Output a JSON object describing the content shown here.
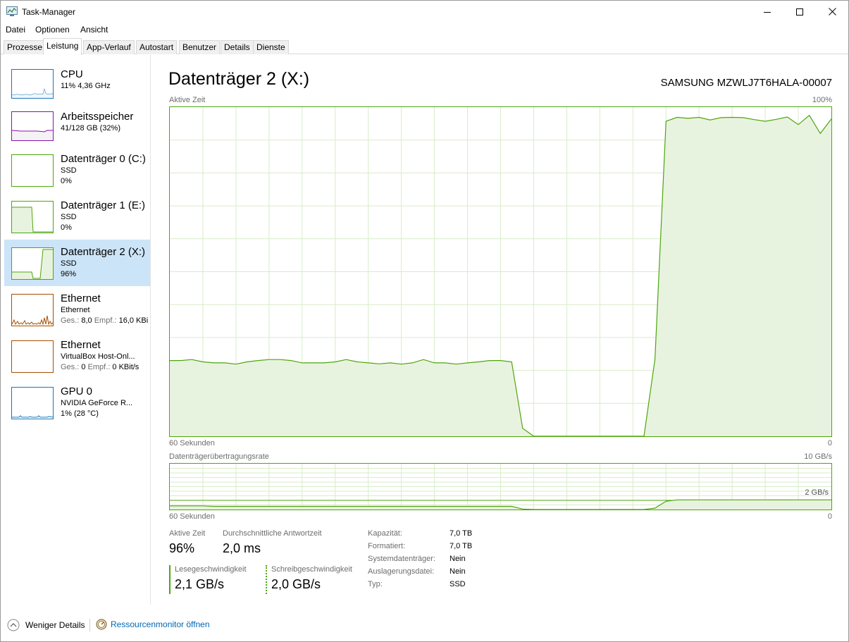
{
  "window": {
    "title": "Task-Manager"
  },
  "menu": [
    "Datei",
    "Optionen",
    "Ansicht"
  ],
  "tabs": [
    "Prozesse",
    "Leistung",
    "App-Verlauf",
    "Autostart",
    "Benutzer",
    "Details",
    "Dienste"
  ],
  "active_tab": "Leistung",
  "sidebar": {
    "items": [
      {
        "title": "CPU",
        "line1": "11% 4,36 GHz",
        "line2": "",
        "color": "#1779ba",
        "selected": false
      },
      {
        "title": "Arbeitsspeicher",
        "line1": "41/128 GB (32%)",
        "line2": "",
        "color": "#8b12ae",
        "selected": false
      },
      {
        "title": "Datenträger 0 (C:)",
        "line1": "SSD",
        "line2": "0%",
        "color": "#4da60c",
        "selected": false
      },
      {
        "title": "Datenträger 1 (E:)",
        "line1": "SSD",
        "line2": "0%",
        "color": "#4da60c",
        "selected": false
      },
      {
        "title": "Datenträger 2 (X:)",
        "line1": "SSD",
        "line2": "96%",
        "color": "#4da60c",
        "selected": true
      },
      {
        "title": "Ethernet",
        "line1": "Ethernet",
        "line2_key1": "Ges.:",
        "line2_val1": "8,0",
        "line2_key2": "Empf.:",
        "line2_val2": "16,0 KBi",
        "color": "#a74f01",
        "selected": false
      },
      {
        "title": "Ethernet",
        "line1": "VirtualBox Host-Onl...",
        "line2_key1": "Ges.:",
        "line2_val1": "0",
        "line2_key2": "Empf.:",
        "line2_val2": "0 KBit/s",
        "color": "#a74f01",
        "selected": false
      },
      {
        "title": "GPU 0",
        "line1": "NVIDIA GeForce R...",
        "line2": "1% (28 °C)",
        "color": "#1779ba",
        "selected": false
      }
    ]
  },
  "main": {
    "title": "Datenträger 2 (X:)",
    "model": "SAMSUNG MZWLJ7T6HALA-00007",
    "active_chart": {
      "label": "Aktive Zeit",
      "max_label": "100%",
      "x_left": "60 Sekunden",
      "x_right": "0"
    },
    "transfer_chart": {
      "label": "Datenträgerübertragungsrate",
      "max_label": "10 GB/s",
      "mid_label": "2 GB/s",
      "x_left": "60 Sekunden",
      "x_right": "0"
    },
    "stats": {
      "active_time_label": "Aktive Zeit",
      "active_time_value": "96%",
      "avg_response_label": "Durchschnittliche Antwortzeit",
      "avg_response_value": "2,0 ms",
      "read_label": "Lesegeschwindigkeit",
      "read_value": "2,1 GB/s",
      "write_label": "Schreibgeschwindigkeit",
      "write_value": "2,0 GB/s"
    },
    "properties": [
      {
        "key": "Kapazität:",
        "value": "7,0 TB"
      },
      {
        "key": "Formatiert:",
        "value": "7,0 TB"
      },
      {
        "key": "Systemdatenträger:",
        "value": "Nein"
      },
      {
        "key": "Auslagerungsdatei:",
        "value": "Nein"
      },
      {
        "key": "Typ:",
        "value": "SSD"
      }
    ]
  },
  "footer": {
    "less_details": "Weniger Details",
    "resource_monitor": "Ressourcenmonitor öffnen"
  },
  "chart_data": [
    {
      "type": "area",
      "title": "Aktive Zeit",
      "xlabel": "60 Sekunden",
      "ylim": [
        0,
        100
      ],
      "unit": "%",
      "x": [
        60,
        59,
        58,
        57,
        56,
        55,
        54,
        53,
        52,
        51,
        50,
        49,
        48,
        47,
        46,
        45,
        44,
        43,
        42,
        41,
        40,
        39,
        38,
        37,
        36,
        35,
        34,
        33,
        32,
        31,
        30,
        29,
        28,
        27,
        26,
        25,
        24,
        23,
        22,
        21,
        20,
        19,
        18,
        17,
        16,
        15,
        14,
        13,
        12,
        11,
        10,
        9,
        8,
        7,
        6,
        5,
        4,
        3,
        2,
        1,
        0
      ],
      "series": [
        {
          "values": [
            23,
            23,
            23.3,
            22.6,
            22.3,
            22.3,
            21.9,
            22.6,
            23,
            23.3,
            23.3,
            23,
            22.3,
            22.3,
            22.3,
            22.6,
            23.3,
            22.6,
            22.3,
            22,
            22.3,
            21.9,
            22.3,
            23.3,
            22.3,
            22.3,
            21.9,
            22.3,
            22.6,
            23,
            23,
            22.6,
            2.4,
            0,
            0,
            0,
            0,
            0,
            0,
            0,
            0,
            0,
            0,
            0,
            23.4,
            95.7,
            96.9,
            96.6,
            96.9,
            96.1,
            96.8,
            96.9,
            96.8,
            96.2,
            95.7,
            96.3,
            97,
            94.7,
            97.5,
            92,
            96.4
          ]
        }
      ]
    },
    {
      "type": "area",
      "title": "Datenträgerübertragungsrate",
      "xlabel": "60 Sekunden",
      "ylim": [
        0,
        10
      ],
      "unit": "GB/s",
      "x": [
        60,
        59,
        58,
        57,
        56,
        55,
        54,
        53,
        52,
        51,
        50,
        49,
        48,
        47,
        46,
        45,
        44,
        43,
        42,
        41,
        40,
        39,
        38,
        37,
        36,
        35,
        34,
        33,
        32,
        31,
        30,
        29,
        28,
        27,
        26,
        25,
        24,
        23,
        22,
        21,
        20,
        19,
        18,
        17,
        16,
        15,
        14,
        13,
        12,
        11,
        10,
        9,
        8,
        7,
        6,
        5,
        4,
        3,
        2,
        1,
        0
      ],
      "series": [
        {
          "values": [
            0.8,
            0.8,
            0.8,
            0.8,
            0.7,
            0.7,
            0.7,
            0.7,
            0.7,
            0.7,
            0.7,
            0.7,
            0.7,
            0.7,
            0.7,
            0.7,
            0.7,
            0.7,
            0.7,
            0.7,
            0.7,
            0.7,
            0.7,
            0.7,
            0.7,
            0.7,
            0.7,
            0.7,
            0.7,
            0.7,
            0.7,
            0.7,
            0.1,
            0,
            0,
            0,
            0,
            0,
            0,
            0,
            0,
            0,
            0,
            0,
            0.3,
            1.8,
            2.1,
            2.1,
            2.1,
            2.1,
            2.1,
            2.1,
            2.1,
            2.1,
            2.1,
            2.1,
            2.1,
            2.1,
            2.1,
            2.1,
            2.1
          ]
        }
      ]
    }
  ]
}
